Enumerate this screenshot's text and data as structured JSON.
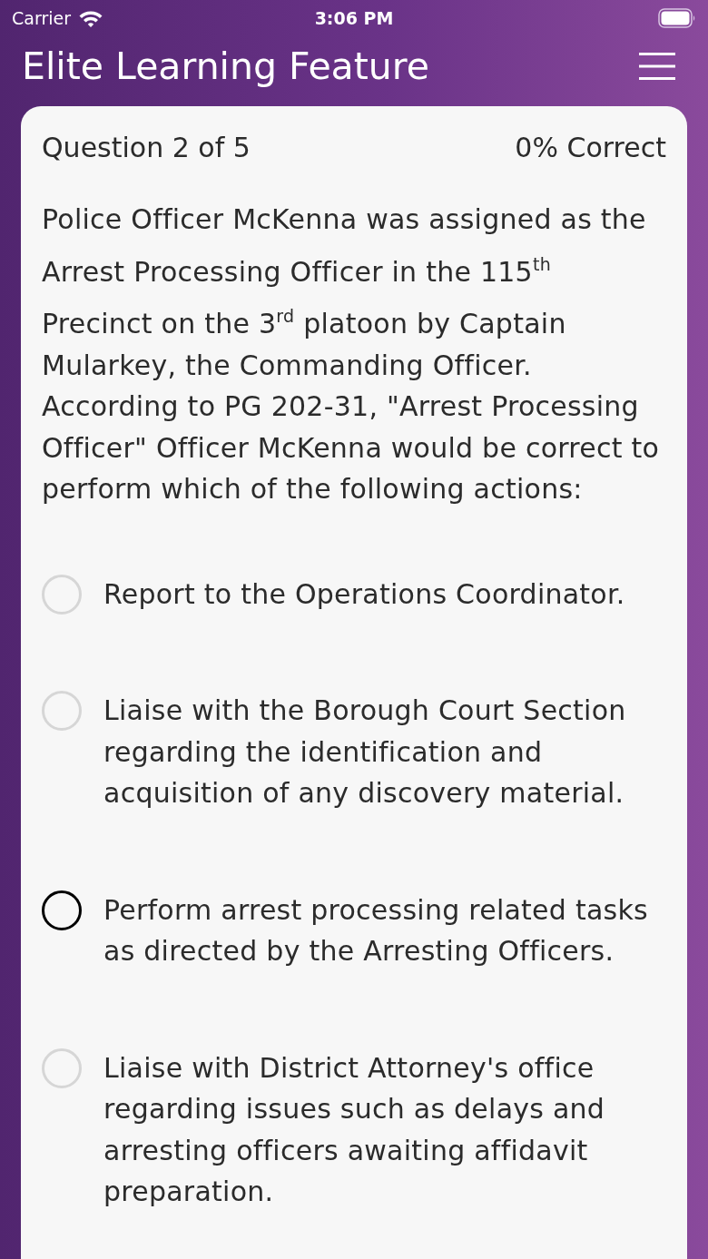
{
  "status_bar": {
    "carrier": "Carrier",
    "time": "3:06 PM"
  },
  "header": {
    "title": "Elite Learning Feature"
  },
  "quiz": {
    "progress": "Question 2 of 5",
    "score": "0% Correct",
    "question": "Police Officer McKenna was assigned as the Arrest Processing Officer in the 115$^{th}$ Precinct on the 3$^{rd}$ platoon by Captain Mularkey, the Commanding Officer. According to PG 202-31, \"Arrest Processing Officer\" Officer McKenna would be correct to perform which of the following actions:",
    "options": [
      {
        "text": "Report to the Operations Coordinator.",
        "selected": false
      },
      {
        "text": "Liaise with the Borough Court Section regarding the identification and acquisition of any discovery material.",
        "selected": false
      },
      {
        "text": "Perform arrest processing related tasks as directed by the Arresting Officers.",
        "selected": true
      },
      {
        "text": "Liaise with District Attorney's office regarding issues such as delays and arresting officers awaiting affidavit preparation.",
        "selected": false
      }
    ]
  }
}
